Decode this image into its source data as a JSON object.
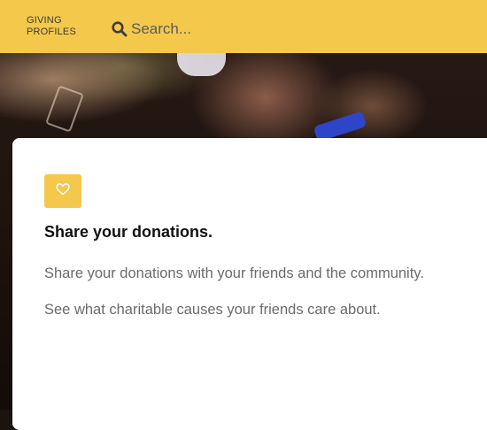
{
  "header": {
    "logo_line1": "GIVING",
    "logo_line2": "PROFILES",
    "search_placeholder": "Search...",
    "search_icon": "search-icon"
  },
  "card": {
    "icon": "heart-icon",
    "title": "Share your donations.",
    "paragraphs": [
      "Share your donations with your friends and the community.",
      "See what charitable causes your friends care about."
    ]
  },
  "colors": {
    "accent": "#f4c84a",
    "card_bg": "#ffffff",
    "body_text": "#6b6b6b"
  }
}
